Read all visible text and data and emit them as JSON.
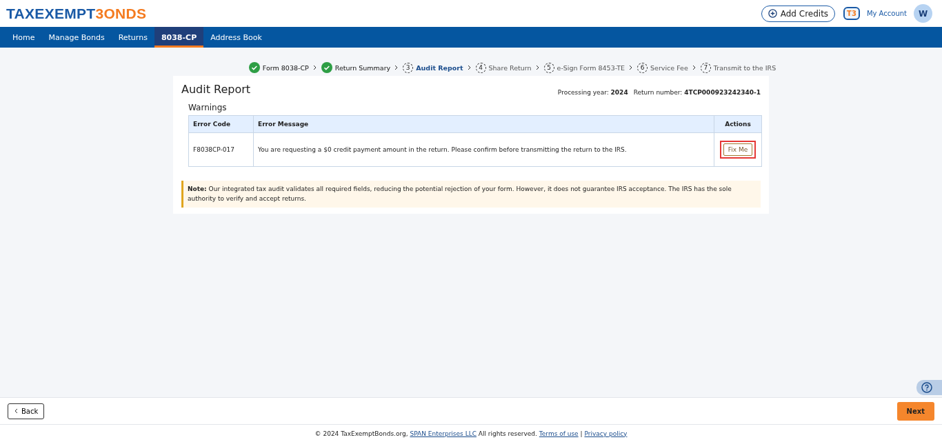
{
  "header": {
    "logo": {
      "part_1": "TAXEXEMPT",
      "part_2": "3ONDS"
    },
    "add_credits": "Add Credits",
    "support_badge": "T3",
    "account": "My Account",
    "avatar": "W"
  },
  "nav": [
    {
      "label": "Home",
      "selected": false
    },
    {
      "label": "Manage Bonds",
      "selected": false
    },
    {
      "label": "Returns",
      "selected": false
    },
    {
      "label": "8038-CP",
      "selected": true
    },
    {
      "label": "Address Book",
      "selected": false
    }
  ],
  "steps": [
    {
      "label": "Form 8038-CP",
      "completed": true,
      "selected": false
    },
    {
      "label": "Return Summary",
      "completed": true,
      "selected": false
    },
    {
      "label": "Audit Report",
      "number": "3",
      "completed": false,
      "selected": true
    },
    {
      "label": "Share Return",
      "number": "4",
      "completed": false,
      "selected": false
    },
    {
      "label": "e-Sign Form 8453-TE",
      "number": "5",
      "completed": false,
      "selected": false
    },
    {
      "label": "Service Fee",
      "number": "6",
      "completed": false,
      "selected": false
    },
    {
      "label": "Transmit to the IRS",
      "number": "7",
      "completed": false,
      "selected": false
    }
  ],
  "report": {
    "title": "Audit Report",
    "processing_year": "Processing year: **2024**",
    "return_number": "Return number: **4TCP000923242340-1**",
    "section": "Warnings",
    "columns": [
      "Error Code",
      "Error Message",
      "Actions"
    ],
    "rows": [
      {
        "code": "F8038CP-017",
        "message": "You are requesting a $0 credit payment amount in the return. Please confirm before transmitting the return to the IRS.",
        "action": "Fix Me",
        "highlighted": true
      }
    ],
    "note": "**Note:** Our integrated tax audit validates all required fields, reducing the potential rejection of your form. However, it does not guarantee IRS acceptance. The IRS has the sole authority to verify and accept returns."
  },
  "footer_bar": {
    "back": "Back",
    "next": "Next"
  },
  "footer": {
    "text_1": "© 2024 TaxExemptBonds.org,",
    "company_link": "SPAN Enterprises LLC",
    "text_2": "All rights reserved.",
    "terms_link": "Terms of use",
    "separator": "|",
    "privacy_link": "Privacy policy"
  }
}
